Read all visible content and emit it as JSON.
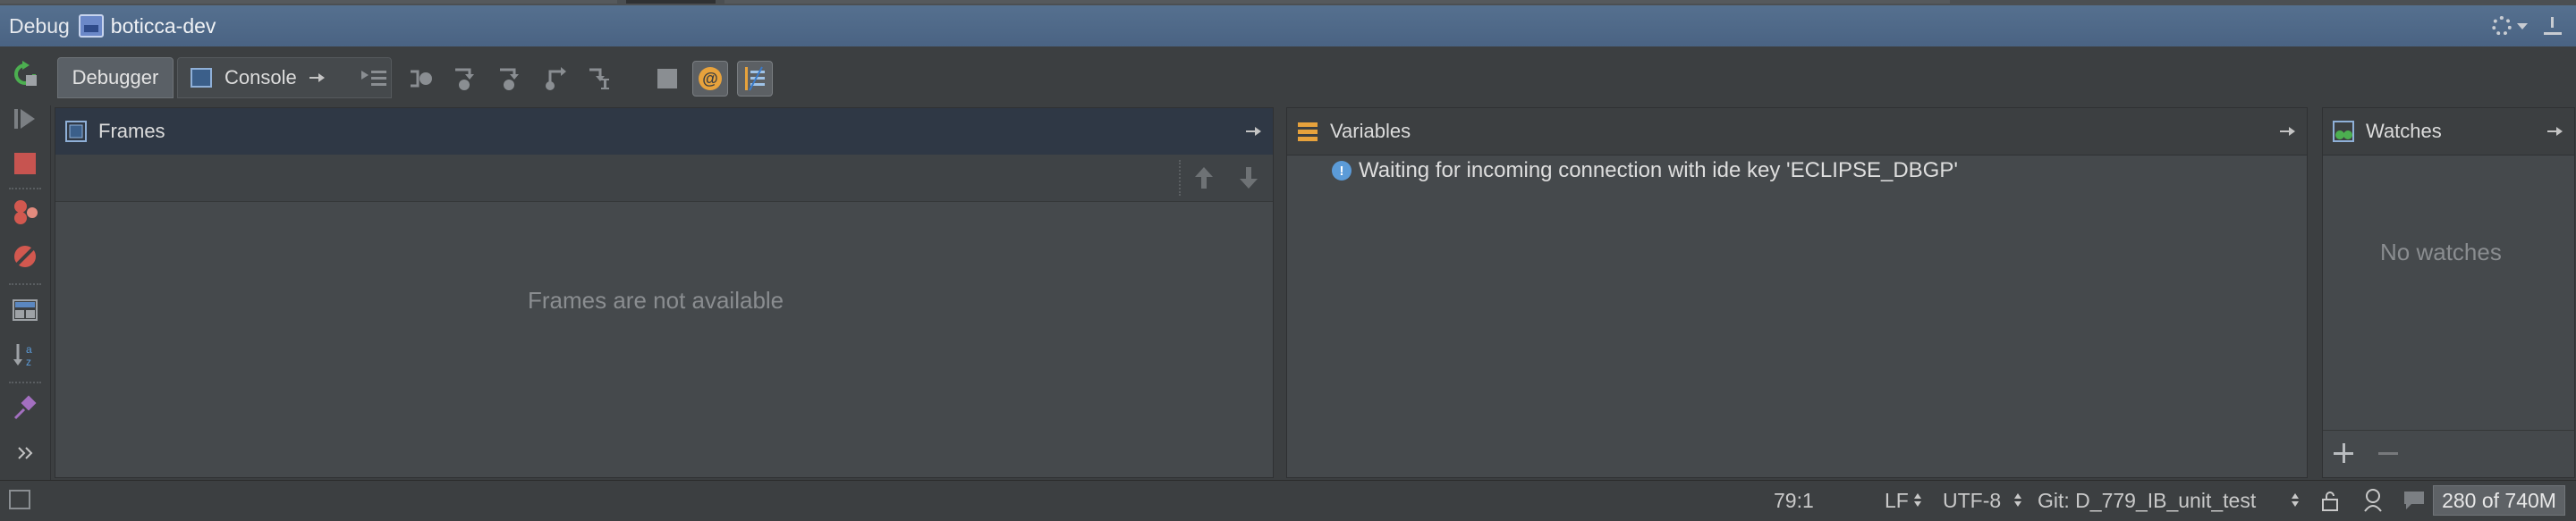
{
  "titlebar": {
    "tool_title": "Debug",
    "project_name": "boticca-dev"
  },
  "tabs": {
    "debugger": "Debugger",
    "console": "Console"
  },
  "panels": {
    "frames": {
      "title": "Frames",
      "empty_message": "Frames are not available"
    },
    "variables": {
      "title": "Variables",
      "message": "Waiting for incoming connection with ide key 'ECLIPSE_DBGP'"
    },
    "watches": {
      "title": "Watches",
      "empty_message": "No watches"
    }
  },
  "statusbar": {
    "position": "79:1",
    "line_separator": "LF",
    "encoding": "UTF-8",
    "vcs_branch": "Git: D_779_IB_unit_test",
    "memory": "280 of 740M"
  },
  "icons": {
    "rerun": "rerun-icon",
    "resume": "resume-icon",
    "stop": "stop-icon",
    "view_breakpoints": "view-breakpoints-icon",
    "mute_breakpoints": "mute-breakpoints-icon",
    "restore_layout": "restore-layout-icon",
    "sort": "sort-alphabetically-icon",
    "pin": "pin-icon",
    "more": "more-icon"
  },
  "colors": {
    "titlebar": "#4f6a8b",
    "background": "#3c3f41",
    "panel": "#45494c",
    "frames_header": "#2f3845",
    "accent_orange": "#e7a23c",
    "stop_red": "#c75450",
    "info_blue": "#5b9bd8"
  }
}
